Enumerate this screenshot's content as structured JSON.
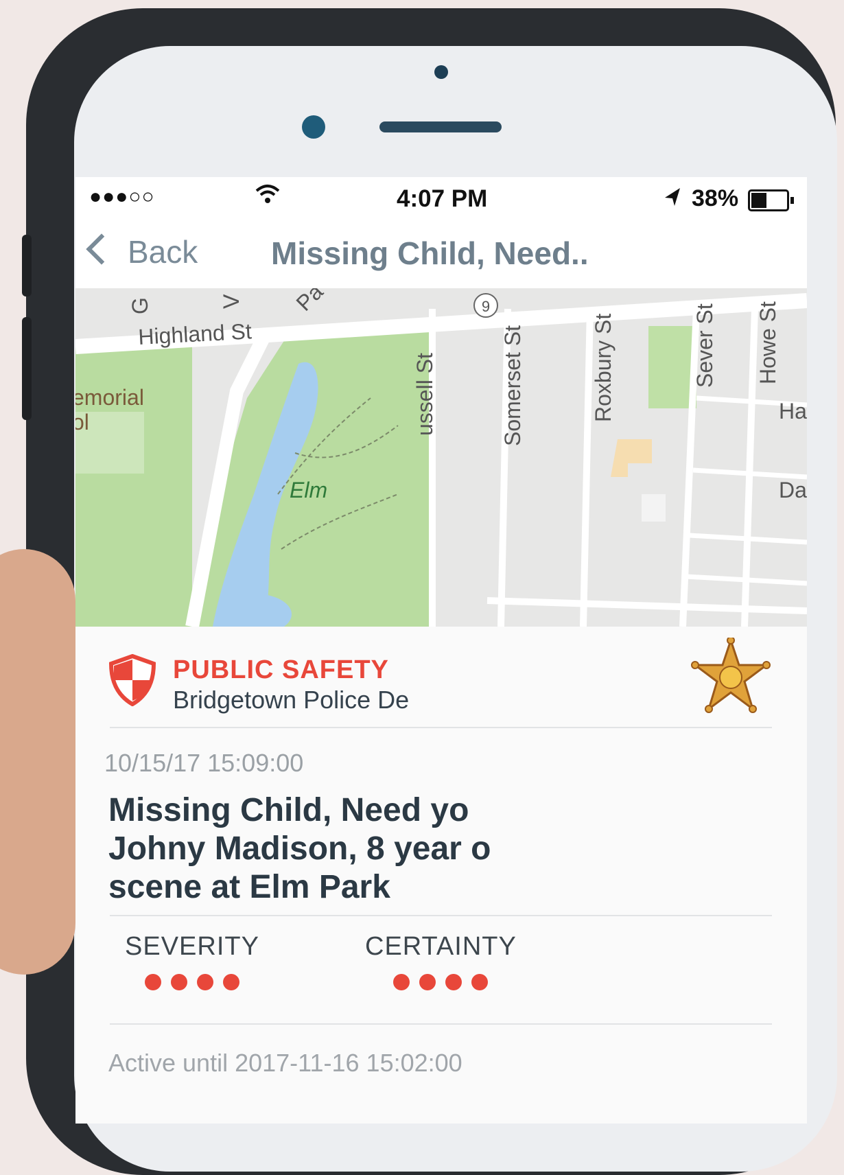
{
  "status_bar": {
    "signal": "●●●○○",
    "time": "4:07 PM",
    "battery_pct": "38%",
    "icons": [
      "wifi-icon",
      "location-arrow-icon",
      "battery-icon"
    ]
  },
  "nav": {
    "back_label": "Back",
    "title": "Missing Child, Need.."
  },
  "map": {
    "labels": {
      "highland": "Highland St",
      "memorial_1": "emorial",
      "memorial_2": "ol",
      "elm": "Elm",
      "russell": "ussell St",
      "somerset": "Somerset St",
      "roxbury": "Roxbury St",
      "sever": "Sever St",
      "howe": "Howe St",
      "ha": "Ha",
      "da": "Da",
      "route": "9",
      "g": "G",
      "v": "V",
      "pa": "Pa"
    }
  },
  "alert": {
    "category": "PUBLIC SAFETY",
    "agency": "Bridgetown Police De",
    "timestamp": "10/15/17 15:09:00",
    "headline_line1": "Missing Child, Need yo",
    "headline_line2": "Johny Madison, 8 year o",
    "headline_line3": "scene at Elm Park",
    "severity_label": "SEVERITY",
    "severity_level": 4,
    "certainty_label": "CERTAINTY",
    "certainty_level": 4,
    "active_until": "Active until 2017-11-16 15:02:00",
    "accent_color": "#e8473a"
  }
}
